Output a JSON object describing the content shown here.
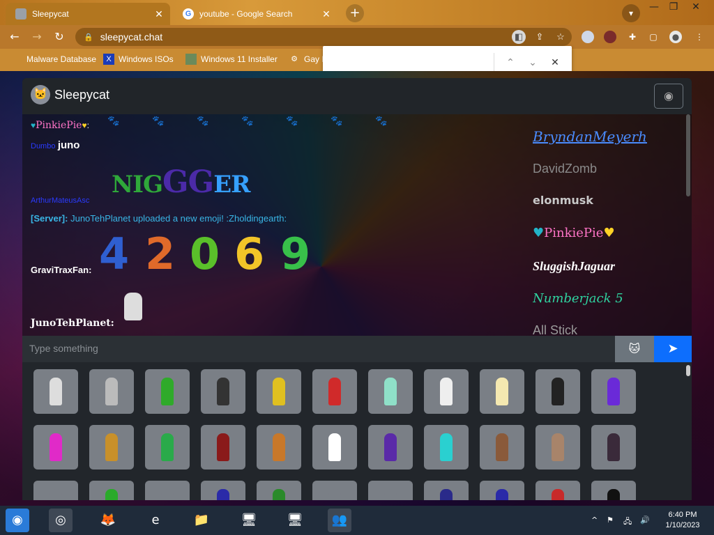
{
  "browser": {
    "tabs": [
      {
        "title": "Sleepycat",
        "active": true
      },
      {
        "title": "youtube - Google Search",
        "active": false
      }
    ],
    "url": "sleepycat.chat",
    "bookmarks": [
      "Malware Database",
      "Windows ISOs",
      "Windows 11 Installer",
      "Gay I"
    ]
  },
  "app": {
    "brand": "Sleepycat"
  },
  "chat": {
    "messages": [
      {
        "user": "PinkiePie",
        "text": ""
      },
      {
        "user": "Dumbo",
        "text": "juno"
      },
      {
        "user": "ArthurMateusAsc",
        "text": "NIGGER",
        "media": "styled-text"
      },
      {
        "user": "[Server]:",
        "text": "JunoTehPlanet uploaded a new emoji! :Zholdingearth:"
      },
      {
        "user": "GraviTraxFan:",
        "text": "42069",
        "media": "number-emoji"
      },
      {
        "user": "JunoTehPlanet:",
        "text": "",
        "media": "sticker"
      }
    ],
    "input_placeholder": "Type something"
  },
  "users": [
    {
      "name": "BryndanMeyerh",
      "color": "#4a8cff"
    },
    {
      "name": "DavidZomb",
      "color": "#8a8a8a"
    },
    {
      "name": "elonmusk",
      "color": "#c8c8c8"
    },
    {
      "name": "PinkiePie",
      "color": "#ff74c7"
    },
    {
      "name": "SluggishJaguar",
      "color": "#ffffff"
    },
    {
      "name": "Numberjack 5",
      "color": "#2fd3a0"
    },
    {
      "name": "All Stick",
      "color": "#9a9a9a"
    }
  ],
  "taskbar": {
    "time": "6:40 PM",
    "date": "1/10/2023"
  },
  "colors": {
    "send": "#0d6efd",
    "server": "#39b6e6"
  }
}
